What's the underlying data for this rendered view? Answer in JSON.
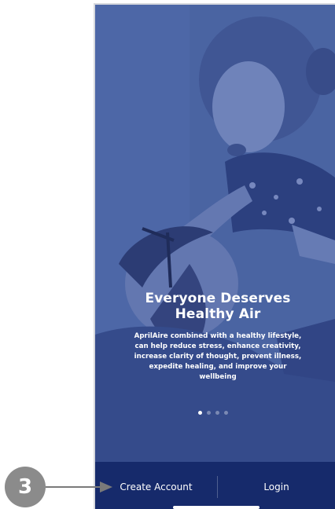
{
  "hero": {
    "headline_line1": "Everyone Deserves",
    "headline_line2": "Healthy Air",
    "body_line1": "AprilAire combined with a healthy lifestyle,",
    "body_line2": "can help reduce stress, enhance creativity,",
    "body_line3": "increase clarity of thought, prevent illness,",
    "body_line4": "expedite healing, and improve your",
    "body_line5": "wellbeing"
  },
  "carousel": {
    "page_count": 4,
    "active_index": 0
  },
  "bottom_bar": {
    "create_account_label": "Create Account",
    "login_label": "Login"
  },
  "callout": {
    "number": "3"
  },
  "colors": {
    "bottom_bar_bg": "#162a6b",
    "overlay_tint": "#4c67a6",
    "callout_gray": "#8b8b8b"
  }
}
